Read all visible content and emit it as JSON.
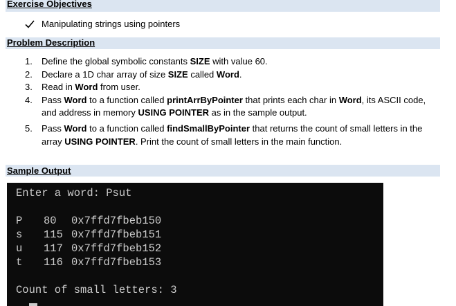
{
  "objectives": {
    "title": "Exercise Objectives",
    "item": "Manipulating strings using pointers"
  },
  "problem": {
    "title": "Problem Description",
    "items": [
      {
        "num": "1.",
        "parts": [
          {
            "t": "Define the global symbolic constants "
          },
          {
            "t": "SIZE",
            "b": true
          },
          {
            "t": " with value 60."
          }
        ]
      },
      {
        "num": "2.",
        "parts": [
          {
            "t": "Declare a 1D char array of size "
          },
          {
            "t": "SIZE",
            "b": true
          },
          {
            "t": " called "
          },
          {
            "t": "Word",
            "b": true
          },
          {
            "t": "."
          }
        ]
      },
      {
        "num": "3.",
        "parts": [
          {
            "t": "Read in "
          },
          {
            "t": "Word",
            "b": true
          },
          {
            "t": " from user."
          }
        ]
      },
      {
        "num": "4.",
        "parts": [
          {
            "t": "Pass "
          },
          {
            "t": "Word",
            "b": true
          },
          {
            "t": " to a function called "
          },
          {
            "t": "printArrByPointer",
            "b": true
          },
          {
            "t": " that prints each char in "
          },
          {
            "t": "Word",
            "b": true
          },
          {
            "t": ", its ASCII code, and address in memory "
          },
          {
            "t": "USING POINTER",
            "b": true
          },
          {
            "t": " as in the sample output."
          }
        ]
      },
      {
        "num": "5.",
        "parts": [
          {
            "t": "Pass "
          },
          {
            "t": "Word",
            "b": true
          },
          {
            "t": " to a function called "
          },
          {
            "t": "findSmallByPointer",
            "b": true
          },
          {
            "t": " that returns the count of small letters in the array "
          },
          {
            "t": "USING POINTER",
            "b": true
          },
          {
            "t": ". Print the count of small letters in the main function."
          }
        ]
      }
    ]
  },
  "sample": {
    "title": "Sample Output",
    "prompt_line": "Enter a word: Psut",
    "rows": [
      {
        "ch": "P",
        "code": "80",
        "addr": "0x7ffd7fbeb150"
      },
      {
        "ch": "s",
        "code": "115",
        "addr": "0x7ffd7fbeb151"
      },
      {
        "ch": "u",
        "code": "117",
        "addr": "0x7ffd7fbeb152"
      },
      {
        "ch": "t",
        "code": "116",
        "addr": "0x7ffd7fbeb153"
      }
    ],
    "count_line": "Count of small letters: 3"
  }
}
